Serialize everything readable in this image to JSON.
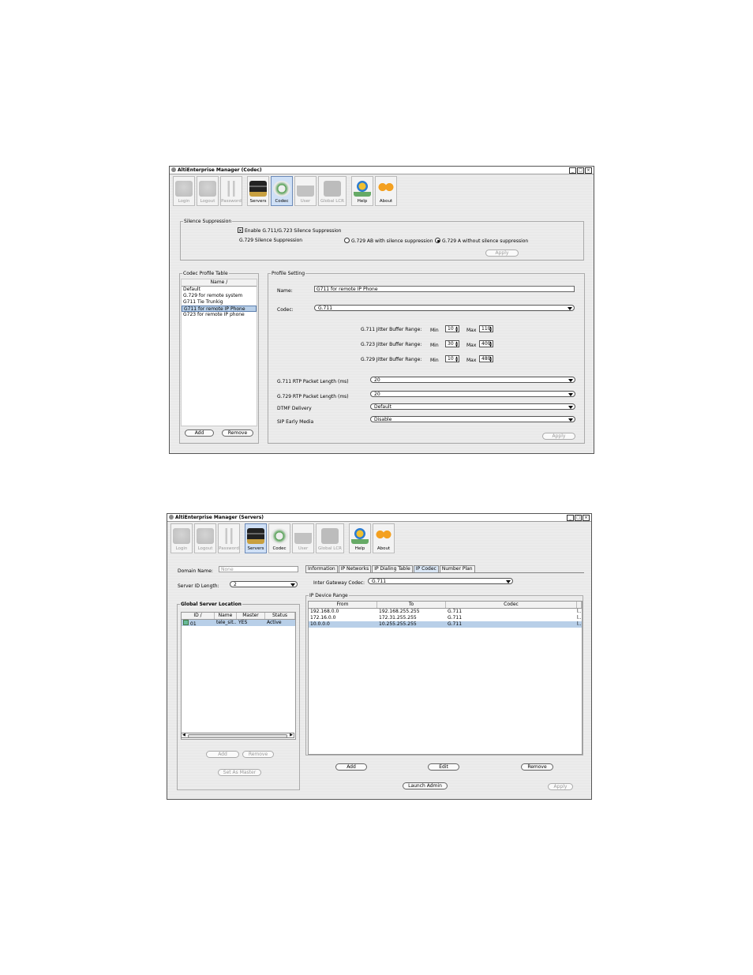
{
  "codec_window": {
    "title": "AltiEnterprise Manager (Codec)",
    "window_buttons": [
      "_",
      "□",
      "×"
    ],
    "toolbar": [
      {
        "label": "Login",
        "icon": "login-icon",
        "disabled": true
      },
      {
        "label": "Logout",
        "icon": "logout-icon",
        "disabled": true
      },
      {
        "label": "Password",
        "icon": "password-keys-icon",
        "disabled": true
      },
      {
        "label": "Servers",
        "icon": "servers-icon",
        "disabled": false
      },
      {
        "label": "Codec",
        "icon": "codec-icon",
        "disabled": false,
        "selected": true
      },
      {
        "label": "User",
        "icon": "user-icon",
        "disabled": true
      },
      {
        "label": "Global LCR",
        "icon": "global-lcr-icon",
        "disabled": true
      },
      {
        "label": "Help",
        "icon": "help-icon",
        "disabled": false
      },
      {
        "label": "About",
        "icon": "about-icon",
        "disabled": false
      }
    ],
    "silence": {
      "legend": "Silence Suppression",
      "enable_label": "Enable G.711/G.723 Silence Suppression",
      "enable_checked": true,
      "g729_label": "G.729 Silence Suppression",
      "radio_ab": "G.729 AB with silence suppression",
      "radio_a": "G.729 A without silence suppression",
      "radio_selected": "a",
      "apply": "Apply"
    },
    "profile_table": {
      "legend": "Codec Profile Table",
      "header": "Name /",
      "rows": [
        "Default",
        "G.729 for remote system",
        "G711 Tie Trunkig",
        "G711 for remote IP Phone",
        "G723 for remote IP phone"
      ],
      "selected_index": 3,
      "add": "Add",
      "remove": "Remove"
    },
    "profile_setting": {
      "legend": "Profile Setting",
      "name_label": "Name:",
      "name_value": "G711 for remote IP Phone",
      "codec_label": "Codec:",
      "codec_value": "G.711",
      "jitter": [
        {
          "label": "G.711 Jitter Buffer Range:",
          "min": "10",
          "max": "110"
        },
        {
          "label": "G.723 Jitter Buffer Range:",
          "min": "30",
          "max": "400"
        },
        {
          "label": "G.729 Jitter Buffer Range:",
          "min": "10",
          "max": "480"
        }
      ],
      "min_label": "Min",
      "max_label": "Max",
      "g711_rtp_label": "G.711 RTP Packet Length (ms)",
      "g711_rtp_value": "20",
      "g729_rtp_label": "G.729 RTP Packet Length (ms)",
      "g729_rtp_value": "20",
      "dtmf_label": "DTMF Delivery",
      "dtmf_value": "Default",
      "sip_label": "SIP Early Media",
      "sip_value": "Disable",
      "apply": "Apply"
    }
  },
  "servers_window": {
    "title": "AltiEnterprise Manager (Servers)",
    "window_buttons": [
      "_",
      "□",
      "×"
    ],
    "toolbar": [
      {
        "label": "Login",
        "icon": "login-icon",
        "disabled": true
      },
      {
        "label": "Logout",
        "icon": "logout-icon",
        "disabled": true
      },
      {
        "label": "Password",
        "icon": "password-keys-icon",
        "disabled": true
      },
      {
        "label": "Servers",
        "icon": "servers-icon",
        "disabled": false,
        "selected": true
      },
      {
        "label": "Codec",
        "icon": "codec-icon",
        "disabled": false
      },
      {
        "label": "User",
        "icon": "user-icon",
        "disabled": true
      },
      {
        "label": "Global LCR",
        "icon": "global-lcr-icon",
        "disabled": true
      },
      {
        "label": "Help",
        "icon": "help-icon",
        "disabled": false
      },
      {
        "label": "About",
        "icon": "about-icon",
        "disabled": false
      }
    ],
    "domain_label": "Domain Name:",
    "domain_value": "None",
    "server_id_label": "Server ID Length:",
    "server_id_value": "2",
    "location": {
      "legend": "Global Server Location",
      "columns": [
        "ID /",
        "Name",
        "Master",
        "Status"
      ],
      "rows": [
        {
          "id": "01",
          "name": "tele_sit...",
          "master": "YES",
          "status": "Active"
        }
      ],
      "add": "Add",
      "remove": "Remove",
      "set_master": "Set As Master"
    },
    "tabs": [
      "Information",
      "IP Networks",
      "IP Dialing Table",
      "IP Codec",
      "Number Plan"
    ],
    "selected_tab": 3,
    "inter_gateway_label": "Inter Gateway Codec:",
    "inter_gateway_value": "G.711",
    "range": {
      "legend": "IP Device Range",
      "columns": [
        "From",
        "To",
        "Codec",
        ""
      ],
      "rows": [
        {
          "from": "192.168.0.0",
          "to": "192.168.255.255",
          "codec": "G.711",
          "extra": "l..."
        },
        {
          "from": "172.16.0.0",
          "to": "172.31.255.255",
          "codec": "G.711",
          "extra": "l..."
        },
        {
          "from": "10.0.0.0",
          "to": "10.255.255.255",
          "codec": "G.711",
          "extra": "l..."
        }
      ],
      "selected_index": 2
    },
    "add": "Add",
    "edit": "Edit",
    "remove": "Remove",
    "launch_admin": "Launch Admin",
    "apply": "Apply"
  }
}
